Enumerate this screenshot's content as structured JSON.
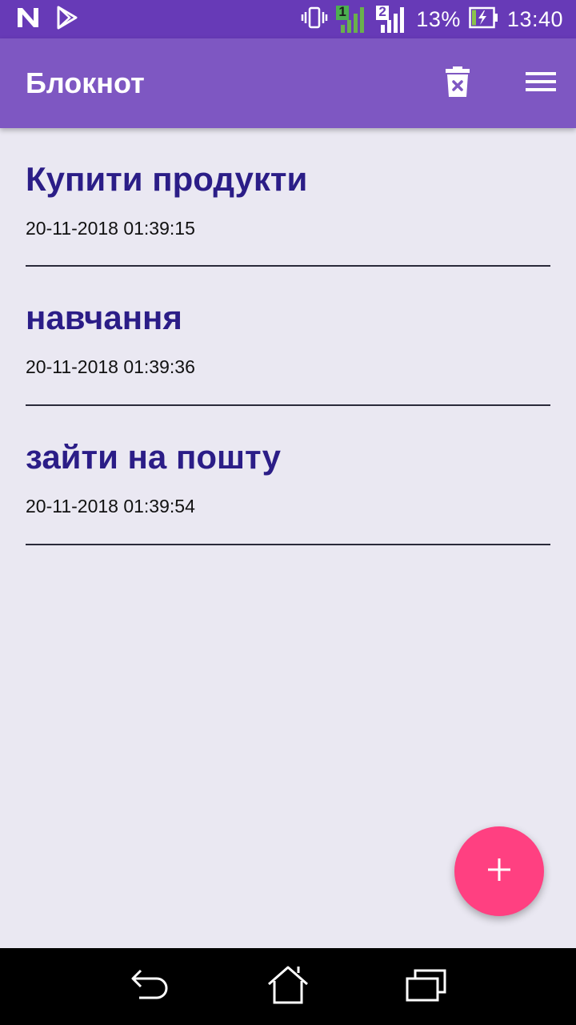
{
  "status_bar": {
    "icons_left": [
      "notification-n-icon",
      "play-store-icon"
    ],
    "icons_right": [
      "vibrate-icon",
      "sim1-signal-icon",
      "sim2-signal-icon",
      "battery-charging-icon"
    ],
    "sim1_label": "1",
    "sim2_label": "2",
    "battery_percent": "13%",
    "time": "13:40"
  },
  "app_bar": {
    "title": "Блокнот",
    "actions": [
      "delete-icon",
      "menu-icon"
    ]
  },
  "notes": [
    {
      "title": "Купити продукти",
      "date": "20-11-2018 01:39:15"
    },
    {
      "title": "навчання",
      "date": "20-11-2018 01:39:36"
    },
    {
      "title": "зайти на пошту",
      "date": "20-11-2018 01:39:54"
    }
  ],
  "fab": {
    "icon": "plus-icon"
  },
  "nav_bar": {
    "buttons": [
      "back-icon",
      "home-icon",
      "recents-icon"
    ]
  },
  "colors": {
    "status_bar": "#673ab7",
    "app_bar": "#7e57c2",
    "note_title": "#2b1d87",
    "fab": "#ff4081",
    "background": "#eae8f2"
  }
}
